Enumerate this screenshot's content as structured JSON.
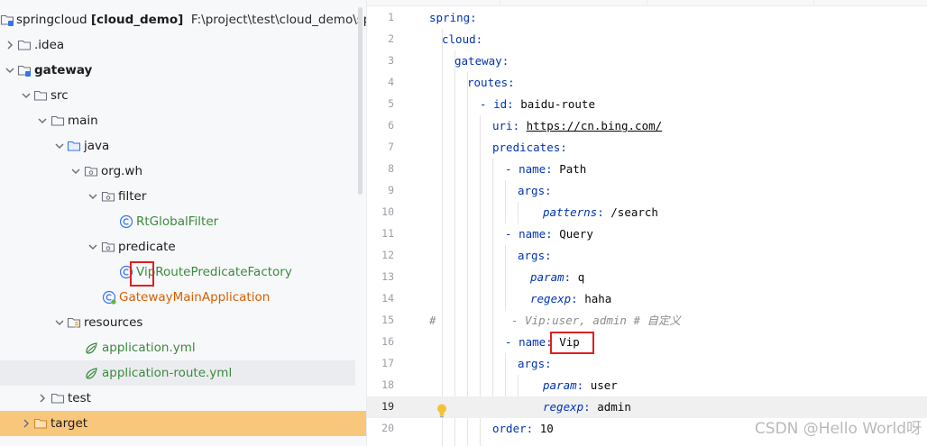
{
  "tree": {
    "root": {
      "name": "springcloud",
      "module": "[cloud_demo]",
      "path": "F:\\project\\test\\cloud_demo\\springcloud"
    },
    "rows": [
      {
        "id": "idea",
        "label": ".idea",
        "icon": "folder-icon",
        "chevron": "right"
      },
      {
        "id": "gateway",
        "label": "gateway",
        "icon": "module-folder-icon",
        "chevron": "down"
      },
      {
        "id": "src",
        "label": "src",
        "icon": "folder-icon",
        "chevron": "down"
      },
      {
        "id": "main",
        "label": "main",
        "icon": "folder-icon",
        "chevron": "down"
      },
      {
        "id": "java",
        "label": "java",
        "icon": "source-folder-icon",
        "chevron": "down"
      },
      {
        "id": "orgwh",
        "label": "org.wh",
        "icon": "package-icon",
        "chevron": "down"
      },
      {
        "id": "filter",
        "label": "filter",
        "icon": "package-icon",
        "chevron": "down"
      },
      {
        "id": "rtglobal",
        "label": "RtGlobalFilter",
        "icon": "class-icon",
        "chevron": ""
      },
      {
        "id": "predicate",
        "label": "predicate",
        "icon": "package-icon",
        "chevron": "down"
      },
      {
        "id": "vipfactory",
        "label": "VipRoutePredicateFactory",
        "icon": "class-icon",
        "chevron": ""
      },
      {
        "id": "gwmain",
        "label": "GatewayMainApplication",
        "icon": "spring-boot-class-icon",
        "chevron": ""
      },
      {
        "id": "resources",
        "label": "resources",
        "icon": "resources-folder-icon",
        "chevron": "down"
      },
      {
        "id": "appyml",
        "label": "application.yml",
        "icon": "spring-yaml-icon",
        "chevron": ""
      },
      {
        "id": "approute",
        "label": "application-route.yml",
        "icon": "spring-yaml-icon",
        "chevron": ""
      },
      {
        "id": "test",
        "label": "test",
        "icon": "folder-icon",
        "chevron": "right"
      },
      {
        "id": "target",
        "label": "target",
        "icon": "folder-icon",
        "chevron": "right"
      }
    ]
  },
  "editor": {
    "lines": [
      {
        "n": "1",
        "key": "spring",
        "sep": ":",
        "val": ""
      },
      {
        "n": "2",
        "key": "cloud",
        "sep": ":",
        "val": ""
      },
      {
        "n": "3",
        "key": "gateway",
        "sep": ":",
        "val": ""
      },
      {
        "n": "4",
        "key": "routes",
        "sep": ":",
        "val": ""
      },
      {
        "n": "5",
        "dash": "- ",
        "key": "id",
        "sep": ": ",
        "val": "baidu-route"
      },
      {
        "n": "6",
        "key": "uri",
        "sep": ": ",
        "val": "https://cn.bing.com/"
      },
      {
        "n": "7",
        "key": "predicates",
        "sep": ":",
        "val": ""
      },
      {
        "n": "8",
        "dash": "- ",
        "key": "name",
        "sep": ": ",
        "val": "Path"
      },
      {
        "n": "9",
        "key": "args",
        "sep": ":",
        "val": ""
      },
      {
        "n": "10",
        "key": "patterns",
        "sep": ": ",
        "val": "/search"
      },
      {
        "n": "11",
        "dash": "- ",
        "key": "name",
        "sep": ": ",
        "val": "Query"
      },
      {
        "n": "12",
        "key": "args",
        "sep": ":",
        "val": ""
      },
      {
        "n": "13",
        "key": "param",
        "sep": ": ",
        "val": "q"
      },
      {
        "n": "14",
        "key": "regexp",
        "sep": ": ",
        "val": "haha"
      },
      {
        "n": "15",
        "comment_hash": "#",
        "comment": "- Vip:user, admin # 自定义"
      },
      {
        "n": "16",
        "dash": "- ",
        "key": "name",
        "sep": ": ",
        "val": "Vip"
      },
      {
        "n": "17",
        "key": "args",
        "sep": ":",
        "val": ""
      },
      {
        "n": "18",
        "key": "param",
        "sep": ": ",
        "val": "user"
      },
      {
        "n": "19",
        "key": "regexp",
        "sep": ": ",
        "val": "admin"
      },
      {
        "n": "20",
        "key": "order",
        "sep": ": ",
        "val": "10"
      }
    ],
    "current_line": "19",
    "intention_icon": "lightbulb-icon"
  },
  "watermark": "CSDN @Hello World呀",
  "colors": {
    "key": "#0033b3",
    "highlight_box": "#e02020",
    "target_row": "#f8c77c",
    "green_file": "#3c8a3d",
    "orange_file": "#d65f00"
  }
}
